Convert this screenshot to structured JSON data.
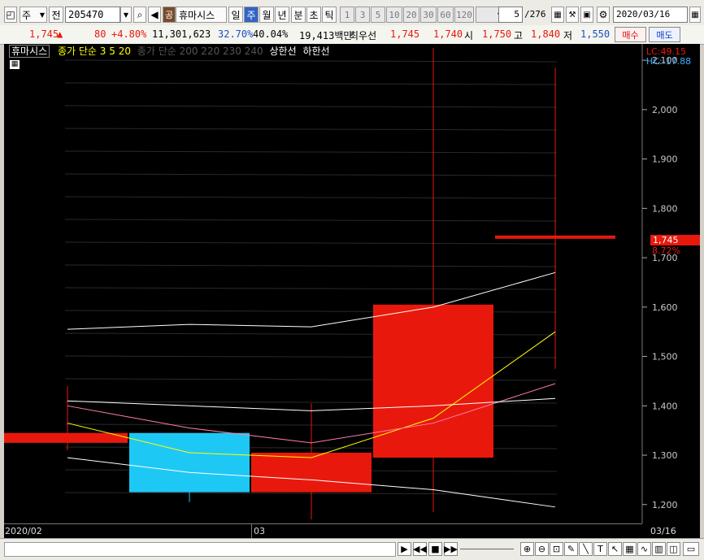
{
  "toolbar": {
    "mode": "주",
    "prefix": "전",
    "code": "205470",
    "brand_badge": "공",
    "stock_name": "휴마시스",
    "periods": [
      "일",
      "주",
      "월",
      "년",
      "분",
      "초",
      "틱"
    ],
    "active_period": "주",
    "nums": [
      "1",
      "3",
      "5",
      "10",
      "20",
      "30",
      "60",
      "120"
    ],
    "page_count": "5",
    "page_total": "/276",
    "date": "2020/03/16"
  },
  "info": {
    "price": "1,745",
    "change": "80",
    "pct": "+4.80%",
    "volume": "11,301,623",
    "ratio1": "32.70%",
    "ratio2": "40.04%",
    "amount": "19,413백만",
    "best_label": "최우선",
    "best_ask": "1,745",
    "best_bid": "1,740",
    "open_label": "시",
    "open": "1,750",
    "high_label": "고",
    "high": "1,840",
    "low_label": "저",
    "low": "1,550",
    "buy_label": "매수",
    "sell_label": "매도"
  },
  "legend": {
    "name": "휴마시스",
    "ma_label": "종가 단순 3 5 20",
    "ma_extra": "종가 단순 200 220 230 240",
    "upper": "상한선",
    "lower": "하한선"
  },
  "right_axis": {
    "lc": "LC:49.15",
    "hc": "HC:-17.88",
    "current_price": "1,745",
    "current_pct": "8.72%"
  },
  "x_labels": {
    "start": "2020/02",
    "mid": "03",
    "end": "03/16"
  },
  "colors": {
    "up": "#e8190c",
    "down": "#1ec8f5",
    "ma3": "#ffff00",
    "ma5": "#ff7ab0",
    "ma20": "#ffffff"
  },
  "chart_data": {
    "type": "candlestick",
    "ylim": [
      1170,
      2120
    ],
    "y_ticks": [
      1200,
      1300,
      1400,
      1500,
      1600,
      1700,
      1800,
      1900,
      2000,
      2100
    ],
    "candles": [
      {
        "open": 1325,
        "close": 1345,
        "high": 1440,
        "low": 1310,
        "dir": "up"
      },
      {
        "open": 1345,
        "close": 1225,
        "high": 1345,
        "low": 1205,
        "dir": "down"
      },
      {
        "open": 1225,
        "close": 1305,
        "high": 1405,
        "low": 1170,
        "dir": "up"
      },
      {
        "open": 1295,
        "close": 1605,
        "high": 2125,
        "low": 1185,
        "dir": "up"
      },
      {
        "open": 1745,
        "close": 1745,
        "high": 2085,
        "low": 1475,
        "dir": "up"
      }
    ],
    "series": [
      {
        "name": "3",
        "color": "#ffff00",
        "values": [
          1365,
          1305,
          1295,
          1375,
          1550
        ]
      },
      {
        "name": "5",
        "color": "#ff7ab0",
        "values": [
          1400,
          1355,
          1325,
          1365,
          1445
        ]
      },
      {
        "name": "20",
        "color": "#ffffff",
        "values": [
          1410,
          1400,
          1390,
          1400,
          1415
        ]
      },
      {
        "name": "상한선",
        "color": "#ffffff",
        "values": [
          1555,
          1565,
          1560,
          1600,
          1670
        ]
      },
      {
        "name": "하한선",
        "color": "#ffffff",
        "values": [
          1295,
          1265,
          1250,
          1230,
          1195
        ]
      }
    ]
  }
}
